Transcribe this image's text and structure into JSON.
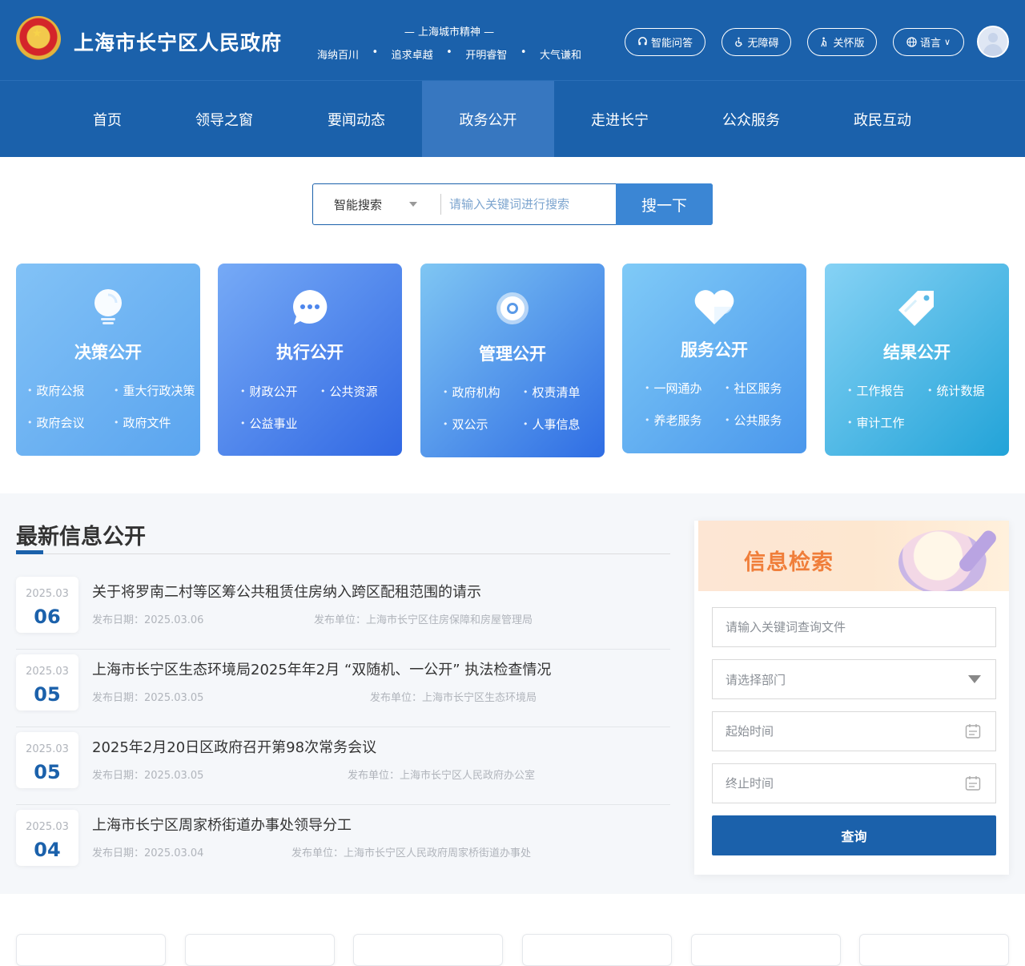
{
  "header": {
    "site_title": "上海市长宁区人民政府",
    "spirit_title": "— 上海城市精神 —",
    "spirit": [
      "海纳百川",
      "追求卓越",
      "开明睿智",
      "大气谦和"
    ],
    "buttons": {
      "qa": "智能问答",
      "accessible": "无障碍",
      "elderly": "关怀版",
      "language": "语言"
    }
  },
  "nav": {
    "items": [
      "首页",
      "领导之窗",
      "要闻动态",
      "政务公开",
      "走进长宁",
      "公众服务",
      "政民互动"
    ],
    "active": "政务公开"
  },
  "search": {
    "mode": "智能搜索",
    "placeholder": "请输入关键词进行搜索",
    "button": "搜一下"
  },
  "cards": [
    {
      "title": "决策公开",
      "icon": "lightbulb-icon",
      "links": [
        "政府公报",
        "重大行政决策",
        "政府会议",
        "政府文件"
      ]
    },
    {
      "title": "执行公开",
      "icon": "chat-bubble-icon",
      "links": [
        "财政公开",
        "公共资源",
        "公益事业"
      ]
    },
    {
      "title": "管理公开",
      "icon": "gear-icon",
      "links": [
        "政府机构",
        "权责清单",
        "双公示",
        "人事信息"
      ]
    },
    {
      "title": "服务公开",
      "icon": "heart-icon",
      "links": [
        "一网通办",
        "社区服务",
        "养老服务",
        "公共服务"
      ]
    },
    {
      "title": "结果公开",
      "icon": "tag-icon",
      "links": [
        "工作报告",
        "统计数据",
        "审计工作"
      ]
    }
  ],
  "latest": {
    "title": "最新信息公开",
    "items": [
      {
        "ym": "2025.03",
        "day": "06",
        "title": "关于将罗南二村等区筹公共租赁住房纳入跨区配租范围的请示",
        "date_label": "发布日期：2025.03.06",
        "unit_label": "发布单位：上海市长宁区住房保障和房屋管理局"
      },
      {
        "ym": "2025.03",
        "day": "05",
        "title": "上海市长宁区生态环境局2025年年2月 “双随机、一公开” 执法检查情况",
        "date_label": "发布日期：2025.03.05",
        "unit_label": "发布单位：上海市长宁区生态环境局"
      },
      {
        "ym": "2025.03",
        "day": "05",
        "title": "2025年2月20日区政府召开第98次常务会议",
        "date_label": "发布日期：2025.03.05",
        "unit_label": "发布单位：上海市长宁区人民政府办公室"
      },
      {
        "ym": "2025.03",
        "day": "04",
        "title": "上海市长宁区周家桥街道办事处领导分工",
        "date_label": "发布日期：2025.03.04",
        "unit_label": "发布单位：上海市长宁区人民政府周家桥街道办事处"
      }
    ]
  },
  "retrieval": {
    "title": "信息检索",
    "keyword_placeholder": "请输入关键词查询文件",
    "dept_placeholder": "请选择部门",
    "start_placeholder": "起始时间",
    "end_placeholder": "终止时间",
    "button": "查询"
  },
  "colors": {
    "primary": "#1b61ab",
    "nav_active": "#3777c0",
    "search_button": "#3b86d4",
    "retrieval_title": "#f07e3a"
  }
}
